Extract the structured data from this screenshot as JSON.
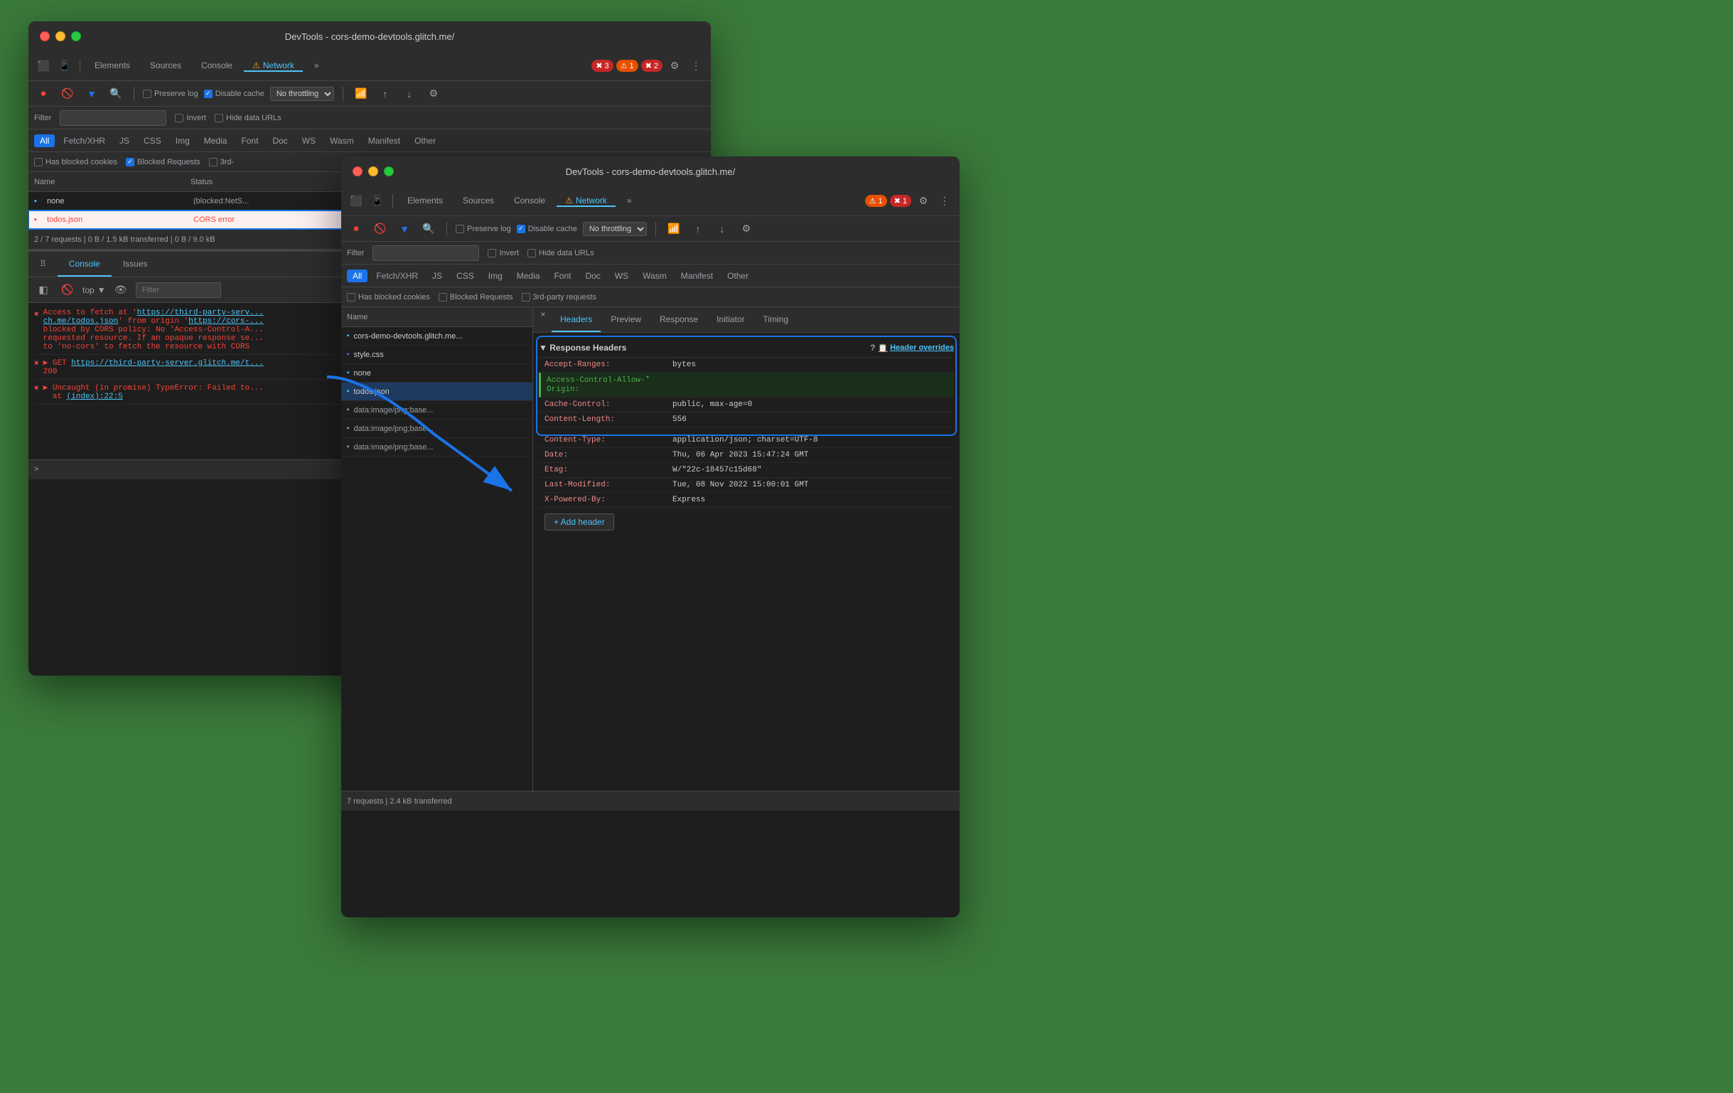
{
  "window1": {
    "title": "DevTools - cors-demo-devtools.glitch.me/",
    "tabs": [
      "Elements",
      "Sources",
      "Console",
      "Network",
      "⋮"
    ],
    "active_tab": "Network",
    "badges": [
      {
        "type": "error",
        "count": "3"
      },
      {
        "type": "warning",
        "count": "1"
      },
      {
        "type": "error",
        "count": "2"
      }
    ],
    "controls": {
      "preserve_log": "Preserve log",
      "disable_cache": "Disable cache",
      "throttle": "No throttling"
    },
    "filter_label": "Filter",
    "filter_types": [
      "All",
      "Fetch/XHR",
      "JS",
      "CSS",
      "Img",
      "Media",
      "Font",
      "Doc",
      "WS",
      "Wasm",
      "Manifest",
      "Other"
    ],
    "active_filter": "All",
    "checkboxes": {
      "invert": "Invert",
      "hide_data_urls": "Hide data URLs",
      "has_blocked_cookies": "Has blocked cookies",
      "blocked_requests": "Blocked Requests",
      "third_party": "3rd-"
    },
    "table_headers": [
      "Name",
      "Status"
    ],
    "rows": [
      {
        "name": "none",
        "status": "(blocked:NetS...",
        "error": false,
        "selected": false
      },
      {
        "name": "todos.json",
        "status": "CORS error",
        "error": true,
        "selected": true,
        "highlighted": true
      }
    ],
    "status_bar": "2 / 7 requests   |   0 B / 1.5 kB transferred   |   0 B / 9.0 kB",
    "console_tabs": [
      "Console",
      "Issues"
    ],
    "active_console_tab": "Console",
    "console_controls": {
      "top": "top"
    },
    "console_messages": [
      {
        "type": "error",
        "text": "Access to fetch at 'https://third-party-serv...\nch.me/todos.json' from origin 'https://cors-...\nblocked by CORS policy: No 'Access-Control-A...\nrequested resource. If an opaque response se...\nto 'no-cors' to fetch the resource with CORS"
      },
      {
        "type": "error",
        "text": "▶ GET https://third-party-server.glitch.me/t...\n200"
      },
      {
        "type": "error",
        "text": "▶ Uncaught (in promise) TypeError: Failed to...\n at (index):22:5"
      }
    ]
  },
  "window2": {
    "title": "DevTools - cors-demo-devtools.glitch.me/",
    "tabs": [
      "Elements",
      "Sources",
      "Console",
      "Network",
      "⋮"
    ],
    "active_tab": "Network",
    "badges": [
      {
        "type": "warning",
        "count": "1"
      },
      {
        "type": "error",
        "count": "1"
      }
    ],
    "controls": {
      "preserve_log": "Preserve log",
      "disable_cache": "Disable cache",
      "throttle": "No throttling"
    },
    "filter_label": "Filter",
    "filter_types": [
      "All",
      "Fetch/XHR",
      "JS",
      "CSS",
      "Img",
      "Media",
      "Font",
      "Doc",
      "WS",
      "Wasm",
      "Manifest",
      "Other"
    ],
    "active_filter": "All",
    "checkboxes": {
      "invert": "Invert",
      "hide_data_urls": "Hide data URLs",
      "has_blocked_cookies": "Has blocked cookies",
      "blocked_requests": "Blocked Requests",
      "third_party": "3rd-party requests"
    },
    "table_headers": [
      "Name"
    ],
    "rows": [
      {
        "name": "cors-demo-devtools.glitch.me...",
        "icon": "doc"
      },
      {
        "name": "style.css",
        "icon": "css"
      },
      {
        "name": "none",
        "icon": "doc"
      },
      {
        "name": "todos.json",
        "icon": "doc",
        "selected": true
      },
      {
        "name": "data:image/png;base...",
        "icon": "img"
      },
      {
        "name": "data:image/png;base...",
        "icon": "img"
      },
      {
        "name": "data:image/png;base...",
        "icon": "img"
      }
    ],
    "panel_tabs": [
      "Headers",
      "Preview",
      "Response",
      "Initiator",
      "Timing"
    ],
    "active_panel_tab": "Headers",
    "close_tab": "×",
    "response_headers_title": "▼ Response Headers",
    "header_overrides": "Header overrides",
    "headers": [
      {
        "key": "Accept-Ranges:",
        "value": "bytes",
        "highlight": false
      },
      {
        "key": "Access-Control-Allow-\nOrigin:",
        "value": "*",
        "highlight": true
      },
      {
        "key": "Cache-Control:",
        "value": "public, max-age=0",
        "highlight": false
      },
      {
        "key": "Content-Length:",
        "value": "556",
        "highlight": false
      },
      {
        "key": "Content-Type:",
        "value": "application/json; charset=UTF-8",
        "highlight": false
      },
      {
        "key": "Date:",
        "value": "Thu, 06 Apr 2023 15:47:24 GMT",
        "highlight": false
      },
      {
        "key": "Etag:",
        "value": "W/\"22c-18457c15d68\"",
        "highlight": false
      },
      {
        "key": "Last-Modified:",
        "value": "Tue, 08 Nov 2022 15:00:01 GMT",
        "highlight": false
      },
      {
        "key": "X-Powered-By:",
        "value": "Express",
        "highlight": false
      }
    ],
    "add_header_btn": "+ Add header",
    "status_bar": "7 requests   |   2.4 kB transferred"
  },
  "icons": {
    "stop": "⏹",
    "clear": "🚫",
    "filter": "🔽",
    "search": "🔍",
    "settings": "⚙",
    "more": "⋮",
    "upload": "↑",
    "download": "↓",
    "wifi": "📶",
    "chevron_down": "▼",
    "chevron_right": "▶",
    "eye": "👁",
    "close": "×",
    "question": "?",
    "override": "📋"
  }
}
